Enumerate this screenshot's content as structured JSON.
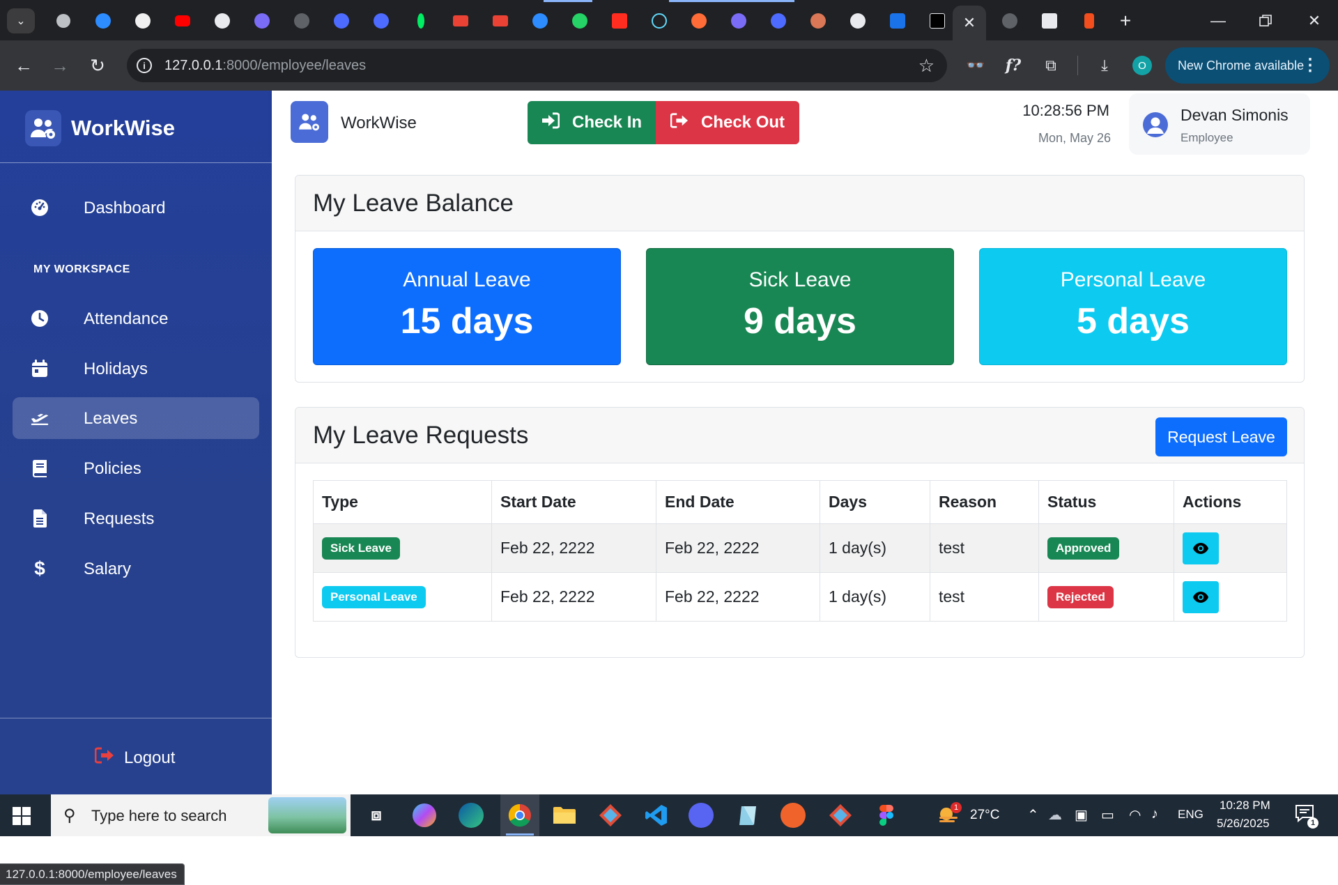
{
  "browser": {
    "active_tab_close": "✕",
    "new_tab": "+",
    "url_host": "127.0.0.1",
    "url_rest": ":8000/employee/leaves",
    "profile_initial": "O",
    "update_label": "New Chrome available",
    "status_url": "127.0.0.1:8000/employee/leaves"
  },
  "app": {
    "brand": "WorkWise",
    "header_brand": "WorkWise",
    "check_in": "Check In",
    "check_out": "Check Out",
    "time": "10:28:56 PM",
    "date": "Mon, May 26",
    "user_name": "Devan Simonis",
    "user_role": "Employee"
  },
  "sidebar": {
    "dashboard": "Dashboard",
    "section": "MY WORKSPACE",
    "items": [
      {
        "label": "Attendance",
        "icon": "clock-icon"
      },
      {
        "label": "Holidays",
        "icon": "calendar-icon"
      },
      {
        "label": "Leaves",
        "icon": "plane-icon",
        "active": true
      },
      {
        "label": "Policies",
        "icon": "book-icon"
      },
      {
        "label": "Requests",
        "icon": "file-icon"
      },
      {
        "label": "Salary",
        "icon": "dollar-icon"
      }
    ],
    "logout": "Logout"
  },
  "balance": {
    "title": "My Leave Balance",
    "cards": [
      {
        "label": "Annual Leave",
        "value": "15 days",
        "color": "#0d6efd"
      },
      {
        "label": "Sick Leave",
        "value": "9 days",
        "color": "#198754"
      },
      {
        "label": "Personal Leave",
        "value": "5 days",
        "color": "#0dcaf0"
      }
    ]
  },
  "requests": {
    "title": "My Leave Requests",
    "button": "Request Leave",
    "columns": [
      "Type",
      "Start Date",
      "End Date",
      "Days",
      "Reason",
      "Status",
      "Actions"
    ],
    "rows": [
      {
        "type": "Sick Leave",
        "type_color": "#198754",
        "start": "Feb 22, 2222",
        "end": "Feb 22, 2222",
        "days": "1 day(s)",
        "reason": "test",
        "status": "Approved",
        "status_color": "#198754"
      },
      {
        "type": "Personal Leave",
        "type_color": "#0dcaf0",
        "start": "Feb 22, 2222",
        "end": "Feb 22, 2222",
        "days": "1 day(s)",
        "reason": "test",
        "status": "Rejected",
        "status_color": "#dc3545"
      }
    ]
  },
  "taskbar": {
    "search_placeholder": "Type here to search",
    "weather": "27°C",
    "weather_badge": "1",
    "lang": "ENG",
    "time": "10:28 PM",
    "date": "5/26/2025",
    "notif_count": "1"
  }
}
